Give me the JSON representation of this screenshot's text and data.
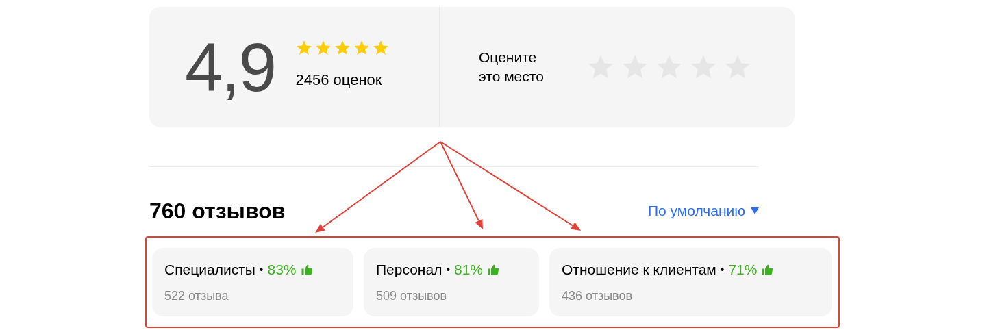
{
  "rating": {
    "score": "4,9",
    "stars": 5,
    "count": "2456 оценок"
  },
  "rate_prompt": {
    "label": "Оцените это место"
  },
  "reviews": {
    "title": "760 отзывов",
    "sort": "По умолчанию"
  },
  "aspects": [
    {
      "name": "Специалисты",
      "separator": "•",
      "percent": "83%",
      "reviews": "522 отзыва"
    },
    {
      "name": "Персонал",
      "separator": "•",
      "percent": "81%",
      "reviews": "509 отзывов"
    },
    {
      "name": "Отношение к клиентам",
      "separator": "•",
      "percent": "71%",
      "reviews": "436 отзывов"
    }
  ]
}
